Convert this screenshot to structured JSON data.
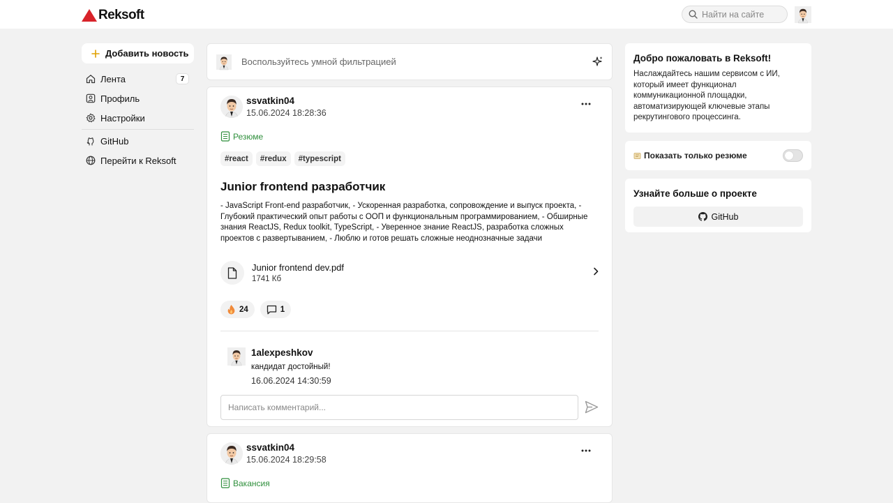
{
  "header": {
    "logo_text": "Reksoft",
    "search_placeholder": "Найти на сайте"
  },
  "sidebar": {
    "add_label": "Добавить новость",
    "items": [
      {
        "label": "Лента",
        "badge": "7",
        "icon": "home-icon"
      },
      {
        "label": "Профиль",
        "icon": "profile-icon"
      },
      {
        "label": "Настройки",
        "icon": "gear-icon"
      },
      {
        "label": "GitHub",
        "icon": "github-icon"
      },
      {
        "label": "Перейти к Reksoft",
        "icon": "globe-icon"
      }
    ]
  },
  "filter": {
    "text": "Воспользуйтесь умной фильтрацией"
  },
  "posts": [
    {
      "author": "ssvatkin04",
      "date": "15.06.2024 18:28:36",
      "type": "Резюме",
      "tags": [
        "#react",
        "#redux",
        "#typescript"
      ],
      "title": "Junior frontend разработчик",
      "body": "- JavaScript Front-end разработчик, - Ускоренная разработка, сопровождение и выпуск проекта, - Глубокий практический опыт работы с ООП и функциональным программированием, - Обширные знания ReactJS, Redux toolkit, TypeScript, - Уверенное знание ReactJS, разработка сложных проектов с развертыванием, - Люблю и готов решать сложные неоднозначные задачи",
      "file": {
        "name": "Junior frontend dev.pdf",
        "size": "1741 Кб"
      },
      "likes": "24",
      "comments_count": "1",
      "comment": {
        "author": "1alexpeshkov",
        "text": "кандидат достойный!",
        "date": "16.06.2024 14:30:59"
      },
      "comment_placeholder": "Написать комментарий..."
    },
    {
      "author": "ssvatkin04",
      "date": "15.06.2024 18:29:58",
      "type": "Вакансия"
    }
  ],
  "right": {
    "welcome_title": "Добро пожаловать в Reksoft!",
    "welcome_text": "Наслаждайтесь нашим сервисом с ИИ, который имеет функционал коммуникационной площадки, автоматизирующей ключевые этапы рекрутингового процессинга.",
    "toggle_label": "Показать только резюме",
    "toggle_on": false,
    "more_title": "Узнайте больше о проекте",
    "github_label": "GitHub"
  },
  "colors": {
    "accent_green": "#2f8f3c",
    "logo_red": "#d8232a",
    "background": "#f2f2f2"
  }
}
